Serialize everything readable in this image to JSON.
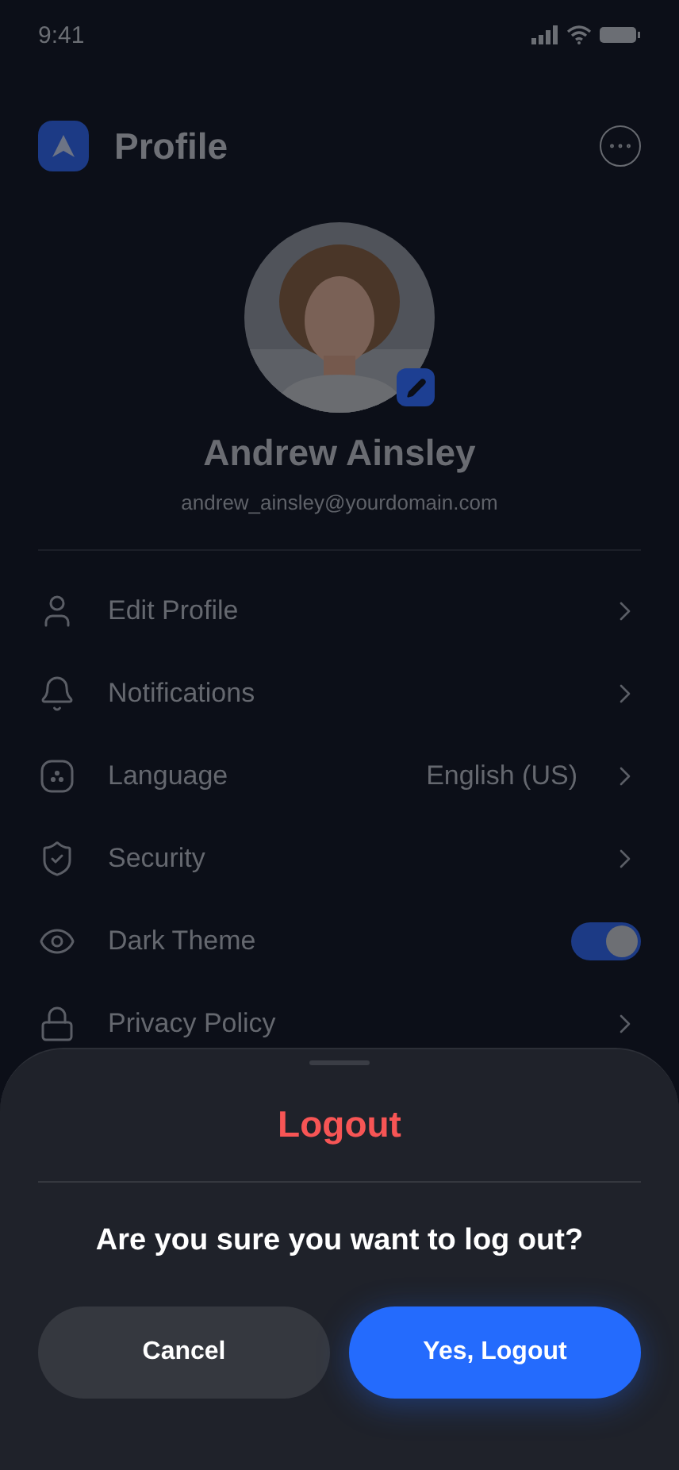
{
  "status_bar": {
    "time": "9:41"
  },
  "header": {
    "title": "Profile"
  },
  "profile": {
    "name": "Andrew Ainsley",
    "email": "andrew_ainsley@yourdomain.com"
  },
  "menu": [
    {
      "kind": "link",
      "label": "Edit Profile"
    },
    {
      "kind": "link",
      "label": "Notifications"
    },
    {
      "kind": "link",
      "label": "Language",
      "value": "English (US)"
    },
    {
      "kind": "link",
      "label": "Security"
    },
    {
      "kind": "toggle",
      "label": "Dark Theme",
      "on": true
    },
    {
      "kind": "link",
      "label": "Privacy Policy"
    }
  ],
  "sheet": {
    "title": "Logout",
    "message": "Are you sure you want to log out?",
    "buttons": [
      {
        "kind": "secondary",
        "label": "Cancel"
      },
      {
        "kind": "primary",
        "label": "Yes, Logout"
      }
    ]
  }
}
